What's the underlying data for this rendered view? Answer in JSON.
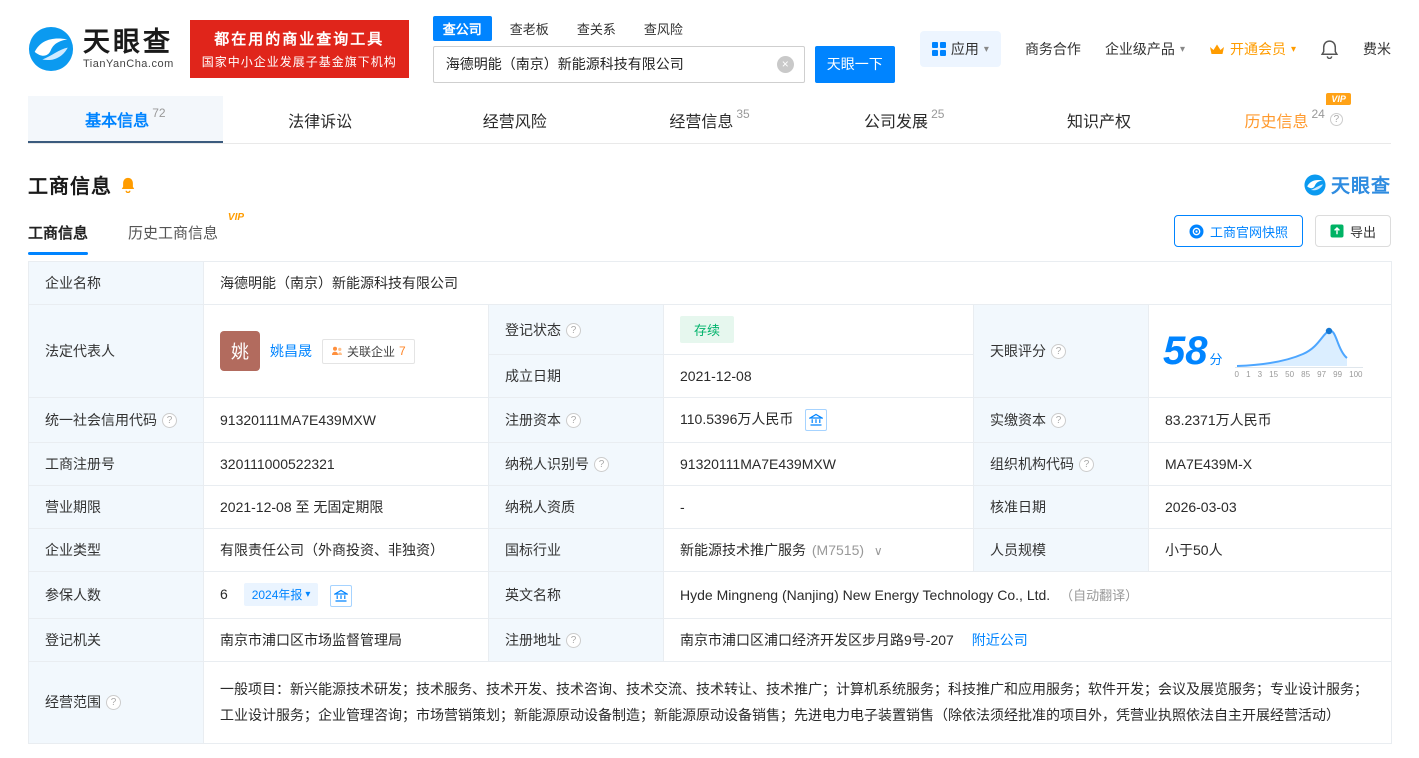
{
  "icons": {
    "info": "?",
    "clear": "×",
    "caret": "▾",
    "chevron": "∨"
  },
  "header": {
    "logo": {
      "title": "天眼查",
      "subtitle": "TianYanCha.com"
    },
    "banner": {
      "line1": "都在用的商业查询工具",
      "line2": "国家中小企业发展子基金旗下机构"
    },
    "search": {
      "tabs": [
        {
          "label": "查公司",
          "active": true
        },
        {
          "label": "查老板"
        },
        {
          "label": "查关系"
        },
        {
          "label": "查风险"
        }
      ],
      "value": "海德明能（南京）新能源科技有限公司",
      "button": "天眼一下"
    },
    "right": {
      "apps": "应用",
      "business": "商务合作",
      "enterprise": "企业级产品",
      "vip": "开通会员",
      "username": "费米"
    }
  },
  "nav_tabs": [
    {
      "label": "基本信息",
      "count": "72",
      "active": true
    },
    {
      "label": "法律诉讼"
    },
    {
      "label": "经营风险"
    },
    {
      "label": "经营信息",
      "count": "35"
    },
    {
      "label": "公司发展",
      "count": "25"
    },
    {
      "label": "知识产权"
    },
    {
      "label": "历史信息",
      "count": "24",
      "vip": "VIP"
    }
  ],
  "section": {
    "title": "工商信息",
    "brand": "天眼查",
    "subtabs": [
      {
        "label": "工商信息",
        "active": true
      },
      {
        "label": "历史工商信息",
        "vip": "VIP"
      }
    ],
    "snapshot_button": "工商官网快照",
    "export_button": "导出"
  },
  "info": {
    "company_name": {
      "label": "企业名称",
      "value": "海德明能（南京）新能源科技有限公司"
    },
    "legal_rep": {
      "label": "法定代表人",
      "avatar": "姚",
      "name": "姚昌晟",
      "related": "关联企业",
      "related_count": "7"
    },
    "reg_status": {
      "label": "登记状态",
      "value": "存续"
    },
    "establish_date": {
      "label": "成立日期",
      "value": "2021-12-08"
    },
    "score": {
      "label": "天眼评分",
      "value": "58",
      "unit": "分",
      "axis": [
        "0",
        "1",
        "3",
        "15",
        "50",
        "85",
        "97",
        "99",
        "100"
      ]
    },
    "credit_code": {
      "label": "统一社会信用代码",
      "value": "91320111MA7E439MXW"
    },
    "reg_capital": {
      "label": "注册资本",
      "value": "110.5396万人民币"
    },
    "paid_capital": {
      "label": "实缴资本",
      "value": "83.2371万人民币"
    },
    "reg_number": {
      "label": "工商注册号",
      "value": "320111000522321"
    },
    "taxpayer_id": {
      "label": "纳税人识别号",
      "value": "91320111MA7E439MXW"
    },
    "org_code": {
      "label": "组织机构代码",
      "value": "MA7E439M-X"
    },
    "business_term": {
      "label": "营业期限",
      "value": "2021-12-08 至 无固定期限"
    },
    "taxpayer_quality": {
      "label": "纳税人资质",
      "value": "-"
    },
    "approval_date": {
      "label": "核准日期",
      "value": "2026-03-03"
    },
    "company_type": {
      "label": "企业类型",
      "value": "有限责任公司（外商投资、非独资）"
    },
    "industry": {
      "label": "国标行业",
      "value": "新能源技术推广服务",
      "code": "(M7515)"
    },
    "staff_size": {
      "label": "人员规模",
      "value": "小于50人"
    },
    "insured": {
      "label": "参保人数",
      "value": "6",
      "badge": "2024年报"
    },
    "english_name": {
      "label": "英文名称",
      "value": "Hyde Mingneng (Nanjing) New Energy Technology Co., Ltd.",
      "note": "（自动翻译）"
    },
    "reg_authority": {
      "label": "登记机关",
      "value": "南京市浦口区市场监督管理局"
    },
    "address": {
      "label": "注册地址",
      "value": "南京市浦口区浦口经济开发区步月路9号-207",
      "link": "附近公司"
    },
    "business_scope": {
      "label": "经营范围",
      "value": "一般项目：新兴能源技术研发；技术服务、技术开发、技术咨询、技术交流、技术转让、技术推广；计算机系统服务；科技推广和应用服务；软件开发；会议及展览服务；专业设计服务；工业设计服务；企业管理咨询；市场营销策划；新能源原动设备制造；新能源原动设备销售；先进电力电子装置销售（除依法须经批准的项目外，凭营业执照依法自主开展经营活动）"
    }
  }
}
